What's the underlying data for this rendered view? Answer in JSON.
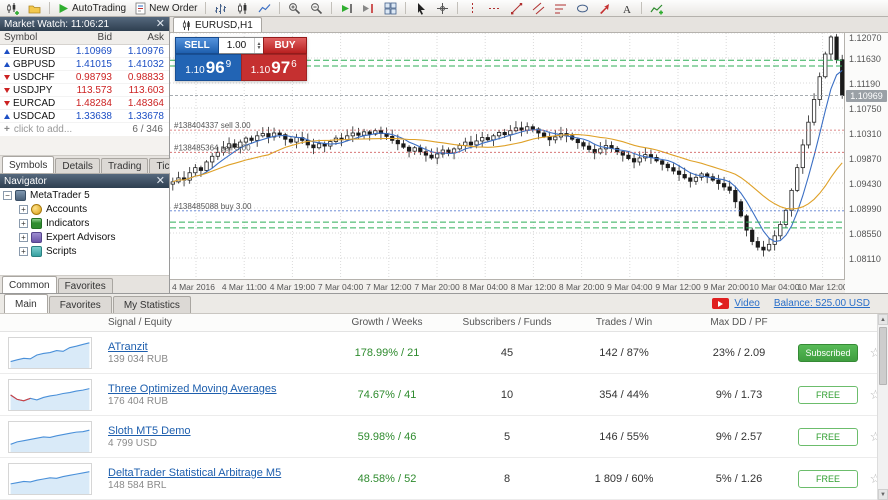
{
  "toolbar": {
    "autotrading_label": "AutoTrading",
    "new_order_label": "New Order",
    "icons": [
      "new-chart",
      "profiles",
      "autotrading-play",
      "new-order-doc",
      "bar-chart",
      "candlestick-chart",
      "line-chart",
      "zoom-in",
      "zoom-out",
      "auto-scroll",
      "chart-shift",
      "tile-windows",
      "cursor",
      "crosshair",
      "vertical-line",
      "horizontal-line",
      "trendline",
      "equidistant-channel",
      "fibonacci",
      "ellipse",
      "arrow-tool",
      "text-tool",
      "indicators-add"
    ]
  },
  "market_watch": {
    "title": "Market Watch: 11:06:21",
    "columns": [
      "Symbol",
      "Bid",
      "Ask"
    ],
    "rows": [
      {
        "symbol": "EURUSD",
        "bid": "1.10969",
        "ask": "1.10976",
        "dir": "up"
      },
      {
        "symbol": "GBPUSD",
        "bid": "1.41015",
        "ask": "1.41032",
        "dir": "up"
      },
      {
        "symbol": "USDCHF",
        "bid": "0.98793",
        "ask": "0.98833",
        "dir": "down"
      },
      {
        "symbol": "USDJPY",
        "bid": "113.573",
        "ask": "113.603",
        "dir": "down"
      },
      {
        "symbol": "EURCAD",
        "bid": "1.48284",
        "ask": "1.48364",
        "dir": "down"
      },
      {
        "symbol": "USDCAD",
        "bid": "1.33638",
        "ask": "1.33678",
        "dir": "up"
      }
    ],
    "add_label": "click to add...",
    "counter": "6 / 346",
    "tabs": [
      "Symbols",
      "Details",
      "Trading",
      "Ticks"
    ],
    "active_tab": "Symbols"
  },
  "navigator": {
    "title": "Navigator",
    "root": "MetaTrader 5",
    "items": [
      "Accounts",
      "Indicators",
      "Expert Advisors",
      "Scripts"
    ],
    "tabs": [
      "Common",
      "Favorites"
    ],
    "active_tab": "Common"
  },
  "chart": {
    "tab_label": "EURUSD,H1",
    "one_click": {
      "sell_label": "SELL",
      "buy_label": "BUY",
      "volume": "1.00",
      "sell_pre": "1.10",
      "sell_big": "96",
      "sell_sup": "9",
      "buy_pre": "1.10",
      "buy_big": "97",
      "buy_sup": "6"
    },
    "price_labels": [
      "1.12070",
      "1.11630",
      "1.11190",
      "1.10750",
      "1.10310",
      "1.09870",
      "1.09430",
      "1.08990",
      "1.08550",
      "1.08110"
    ],
    "current_price": "1.10969",
    "time_labels": [
      "4 Mar 2016",
      "4 Mar 11:00",
      "4 Mar 19:00",
      "7 Mar 04:00",
      "7 Mar 12:00",
      "7 Mar 20:00",
      "8 Mar 04:00",
      "8 Mar 12:00",
      "8 Mar 20:00",
      "9 Mar 04:00",
      "9 Mar 12:00",
      "9 Mar 20:00",
      "10 Mar 04:00",
      "10 Mar 12:00"
    ],
    "annotations": [
      {
        "label": "#138404337 sell 3.00",
        "price": 1.1036,
        "type": "sell"
      },
      {
        "label": "#138485364 sell 3.00",
        "price": 1.0997,
        "type": "sell"
      },
      {
        "label": "#138485088 buy 3.00",
        "price": 1.0894,
        "type": "buy"
      }
    ],
    "dashed_levels": [
      1.1159,
      1.1149,
      1.0874,
      1.0864
    ],
    "chart_data": {
      "type": "candlestick",
      "symbol": "EURUSD",
      "timeframe": "H1",
      "ylim": [
        1.0774,
        1.1207
      ],
      "closes": [
        1.0945,
        1.0952,
        1.0948,
        1.0961,
        1.097,
        1.0965,
        1.098,
        1.099,
        1.0997,
        1.1005,
        1.1012,
        1.1006,
        1.1015,
        1.1022,
        1.1018,
        1.1026,
        1.103,
        1.1024,
        1.1031,
        1.1028,
        1.102,
        1.1015,
        1.1023,
        1.1018,
        1.101,
        1.1005,
        1.1012,
        1.1008,
        1.1016,
        1.1022,
        1.1019,
        1.1026,
        1.1031,
        1.1027,
        1.1033,
        1.1029,
        1.1035,
        1.103,
        1.1025,
        1.1018,
        1.1012,
        1.1006,
        1.0999,
        1.1005,
        1.0998,
        1.0992,
        1.0987,
        1.0994,
        1.1001,
        1.0996,
        1.1003,
        1.1009,
        1.1015,
        1.101,
        1.1017,
        1.1023,
        1.1019,
        1.1026,
        1.1032,
        1.1028,
        1.1035,
        1.104,
        1.1036,
        1.1042,
        1.1038,
        1.1031,
        1.1025,
        1.1019,
        1.1024,
        1.103,
        1.1026,
        1.102,
        1.1014,
        1.1008,
        1.1002,
        1.0996,
        1.1003,
        1.1009,
        1.1004,
        1.0998,
        1.0992,
        1.0986,
        1.098,
        1.0987,
        1.0993,
        1.0988,
        1.0982,
        1.0976,
        1.097,
        1.0964,
        1.0958,
        1.0952,
        1.0946,
        1.0953,
        1.0959,
        1.0954,
        1.0948,
        1.0942,
        1.0936,
        1.093,
        1.091,
        1.0885,
        1.086,
        1.084,
        1.083,
        1.0825,
        1.0835,
        1.085,
        1.087,
        1.0895,
        1.093,
        1.097,
        1.101,
        1.105,
        1.109,
        1.113,
        1.117,
        1.12,
        1.116,
        1.1097
      ]
    }
  },
  "signals": {
    "tabs": [
      "Main",
      "Favorites",
      "My Statistics"
    ],
    "active_tab": "Main",
    "video_label": "Video",
    "balance_label": "Balance: 525.00 USD",
    "columns": [
      "Signal / Equity",
      "Growth / Weeks",
      "Subscribers / Funds",
      "Trades / Win",
      "Max DD / PF"
    ],
    "rows": [
      {
        "name": "ATranzit",
        "equity": "139 034 RUB",
        "growth": "178.99% / 21",
        "subscribers": "45",
        "trades": "142 / 87%",
        "maxdd": "23% / 2.09",
        "action": "Subscribed",
        "action_type": "subscribed",
        "spark": [
          0.15,
          0.22,
          0.28,
          0.26,
          0.42,
          0.48,
          0.52,
          0.6,
          0.57,
          0.72,
          0.78,
          0.85,
          0.92
        ],
        "spark_red_head": 0
      },
      {
        "name": "Three Optimized Moving Averages",
        "equity": "176 404 RUB",
        "growth": "74.67% / 41",
        "subscribers": "10",
        "trades": "354 / 44%",
        "maxdd": "9% / 1.73",
        "action": "FREE",
        "action_type": "free",
        "spark": [
          0.5,
          0.32,
          0.26,
          0.36,
          0.3,
          0.4,
          0.46,
          0.5,
          0.56,
          0.6,
          0.66,
          0.7,
          0.76
        ],
        "spark_red_head": 4
      },
      {
        "name": "Sloth MT5 Demo",
        "equity": "4 799 USD",
        "growth": "59.98% / 46",
        "subscribers": "5",
        "trades": "146 / 55%",
        "maxdd": "9% / 2.57",
        "action": "FREE",
        "action_type": "free",
        "spark": [
          0.2,
          0.3,
          0.35,
          0.4,
          0.45,
          0.5,
          0.48,
          0.55,
          0.6,
          0.65,
          0.7,
          0.72,
          0.78
        ],
        "spark_red_head": 0
      },
      {
        "name": "DeltaTrader Statistical Arbitrage M5",
        "equity": "148 584 BRL",
        "growth": "48.58% / 52",
        "subscribers": "8",
        "trades": "1 809 / 60%",
        "maxdd": "5% / 1.26",
        "action": "FREE",
        "action_type": "free",
        "spark": [
          0.3,
          0.35,
          0.4,
          0.38,
          0.45,
          0.5,
          0.55,
          0.53,
          0.6,
          0.65,
          0.7,
          0.75,
          0.8
        ],
        "spark_red_head": 0
      }
    ]
  },
  "colors": {
    "accent_blue": "#1e5fae",
    "accent_red": "#c53030",
    "level_green": "#2fae57",
    "link_blue": "#2a6fc9",
    "free_green": "#2f9e2f",
    "titlebar": "#2e3f50"
  }
}
